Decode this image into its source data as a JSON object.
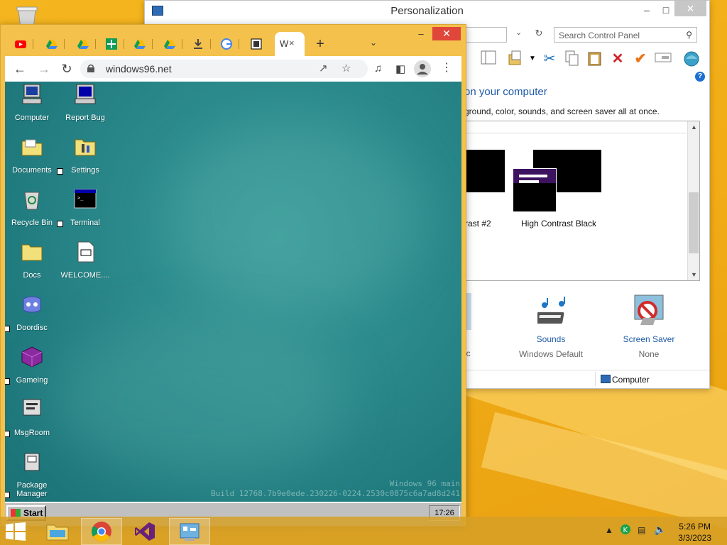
{
  "control_panel": {
    "title": "Personalization",
    "search_placeholder": "Search Control Panel",
    "heading_partial": "on your computer",
    "subheading_partial": "ground, color, sounds, and screen saver all at once.",
    "themes": [
      {
        "label": "rast #2"
      },
      {
        "label": "High Contrast Black"
      }
    ],
    "bottom": {
      "partial_value": "ic",
      "sounds_label": "Sounds",
      "sounds_value": "Windows Default",
      "screensaver_label": "Screen Saver",
      "screensaver_value": "None"
    },
    "status": "Computer"
  },
  "chrome": {
    "url": "windows96.net",
    "active_tab_label": "W",
    "new_tab_symbol": "+"
  },
  "win96": {
    "icons": [
      {
        "label": "Computer"
      },
      {
        "label": "Report Bug"
      },
      {
        "label": "Documents"
      },
      {
        "label": "Settings"
      },
      {
        "label": "Recycle Bin"
      },
      {
        "label": "Terminal"
      },
      {
        "label": "Docs"
      },
      {
        "label": "WELCOME...."
      },
      {
        "label": "Doordisc"
      },
      {
        "label": "Gameing"
      },
      {
        "label": "MsgRoom"
      },
      {
        "label": "Package Manager"
      }
    ],
    "watermark_line1": "Windows 96 main",
    "watermark_line2": "Build 12768.7b9e0ede.230226-0224.2530c0875c6a7ad8d241",
    "start_label": "Start",
    "clock": "17:26"
  },
  "taskbar": {
    "time": "5:26 PM",
    "date": "3/3/2023"
  }
}
